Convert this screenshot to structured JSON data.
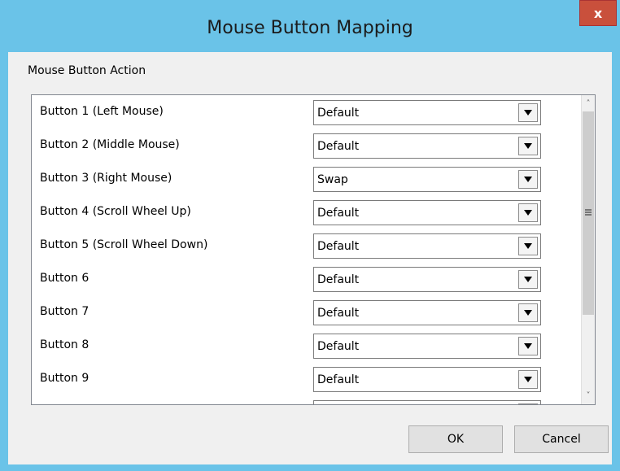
{
  "window": {
    "title": "Mouse Button Mapping",
    "close_glyph": "x",
    "accent_color": "#6ac3e8"
  },
  "group": {
    "label": "Mouse Button Action"
  },
  "rows": [
    {
      "label": "Button 1 (Left Mouse)",
      "value": "Default"
    },
    {
      "label": "Button 2 (Middle Mouse)",
      "value": "Default"
    },
    {
      "label": "Button 3 (Right Mouse)",
      "value": "Swap"
    },
    {
      "label": "Button 4 (Scroll Wheel Up)",
      "value": "Default"
    },
    {
      "label": "Button 5 (Scroll Wheel Down)",
      "value": "Default"
    },
    {
      "label": "Button 6",
      "value": "Default"
    },
    {
      "label": "Button 7",
      "value": "Default"
    },
    {
      "label": "Button 8",
      "value": "Default"
    },
    {
      "label": "Button 9",
      "value": "Default"
    },
    {
      "label": "",
      "value": ""
    }
  ],
  "scrollbar": {
    "up_glyph": "˄",
    "down_glyph": "˅"
  },
  "buttons": {
    "ok_label": "OK",
    "cancel_label": "Cancel"
  }
}
